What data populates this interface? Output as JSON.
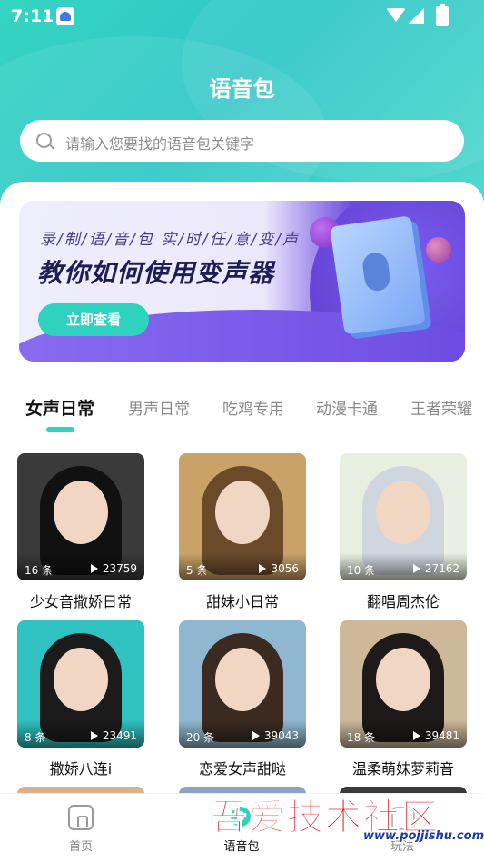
{
  "status_bar": {
    "time": "7:11"
  },
  "header": {
    "title": "语音包"
  },
  "search": {
    "placeholder": "请输入您要找的语音包关键字"
  },
  "banner": {
    "subtitle": "录/制/语/音/包   实/时/任/意/变/声",
    "title": "教你如何使用变声器",
    "button_label": "立即查看"
  },
  "tabs": [
    {
      "label": "女声日常",
      "active": true
    },
    {
      "label": "男声日常",
      "active": false
    },
    {
      "label": "吃鸡专用",
      "active": false
    },
    {
      "label": "动漫卡通",
      "active": false
    },
    {
      "label": "王者荣耀",
      "active": false
    }
  ],
  "items": [
    {
      "title": "少女音撒娇日常",
      "count": "16 条",
      "plays": "23759",
      "bg": "#3a3a3a",
      "hair": "#111111"
    },
    {
      "title": "甜妹小日常",
      "count": "5 条",
      "plays": "3056",
      "bg": "#c9a267",
      "hair": "#6b4a2a"
    },
    {
      "title": "翻唱周杰伦",
      "count": "10 条",
      "plays": "27162",
      "bg": "#e8efe0",
      "hair": "#cfd6dd"
    },
    {
      "title": "撒娇八连i",
      "count": "8 条",
      "plays": "23491",
      "bg": "#2fc2c0",
      "hair": "#1b1b1b"
    },
    {
      "title": "恋爱女声甜哒",
      "count": "20 条",
      "plays": "39043",
      "bg": "#8fb8d0",
      "hair": "#3a2a20"
    },
    {
      "title": "温柔萌妹萝莉音",
      "count": "18 条",
      "plays": "39481",
      "bg": "#cdb89a",
      "hair": "#1f1a1a"
    }
  ],
  "partial_colors": [
    "#d9b08c",
    "#8aa4c8",
    "#3a3a3a"
  ],
  "nav": [
    {
      "label": "首页",
      "icon": "home-icon",
      "active": false
    },
    {
      "label": "语音包",
      "icon": "voice-pack-icon",
      "active": true
    },
    {
      "label": "玩法",
      "icon": "play-icon",
      "active": false
    }
  ],
  "watermark": {
    "text": "吾爱技术社区",
    "url": "www.pojjishu.com"
  },
  "colors": {
    "accent": "#2fd1bf",
    "header_gradient_start": "#35d4c2",
    "header_gradient_end": "#55d9cf"
  }
}
